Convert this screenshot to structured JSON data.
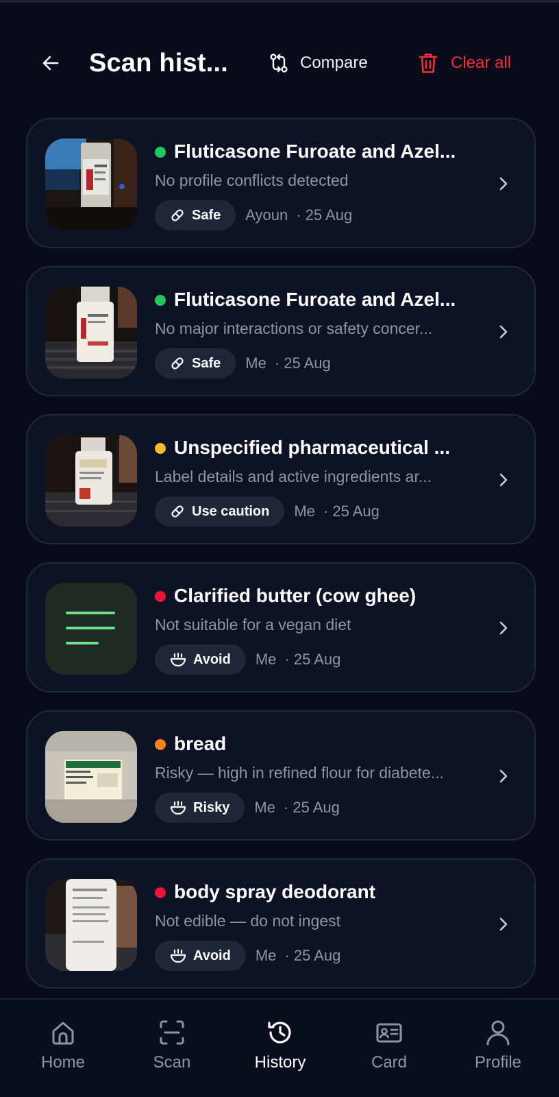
{
  "header": {
    "title": "Scan hist...",
    "compare_label": "Compare",
    "clear_label": "Clear all"
  },
  "colors": {
    "background": "#070b1a",
    "card": "#0d1325",
    "danger": "#f0313b",
    "safe_dot": "#22c55e",
    "caution_dot": "#f5b82e",
    "avoid_dot": "#e8173a",
    "risky_dot": "#f58220"
  },
  "items": [
    {
      "title": "Fluticasone Furoate and Azel...",
      "subtitle": "No profile conflicts detected",
      "badge": "Safe",
      "badge_icon": "pill-icon",
      "by": "Ayoun",
      "date": "· 25 Aug",
      "status": "safe"
    },
    {
      "title": "Fluticasone Furoate and Azel...",
      "subtitle": "No major interactions or safety concer...",
      "badge": "Safe",
      "badge_icon": "pill-icon",
      "by": "Me",
      "date": "· 25 Aug",
      "status": "safe"
    },
    {
      "title": "Unspecified pharmaceutical ...",
      "subtitle": "Label details and active ingredients ar...",
      "badge": "Use caution",
      "badge_icon": "pill-icon",
      "by": "Me",
      "date": "· 25 Aug",
      "status": "caution"
    },
    {
      "title": "Clarified butter (cow ghee)",
      "subtitle": "Not suitable for a vegan diet",
      "badge": "Avoid",
      "badge_icon": "food-bowl-icon",
      "by": "Me",
      "date": "· 25 Aug",
      "status": "avoid"
    },
    {
      "title": "bread",
      "subtitle": "Risky — high in refined flour for diabete...",
      "badge": "Risky",
      "badge_icon": "food-bowl-icon",
      "by": "Me",
      "date": "· 25 Aug",
      "status": "risky"
    },
    {
      "title": "body spray deodorant",
      "subtitle": "Not edible — do not ingest",
      "badge": "Avoid",
      "badge_icon": "food-bowl-icon",
      "by": "Me",
      "date": "· 25 Aug",
      "status": "avoid"
    }
  ],
  "nav": {
    "home": "Home",
    "scan": "Scan",
    "history": "History",
    "card": "Card",
    "profile": "Profile",
    "active": "history"
  }
}
